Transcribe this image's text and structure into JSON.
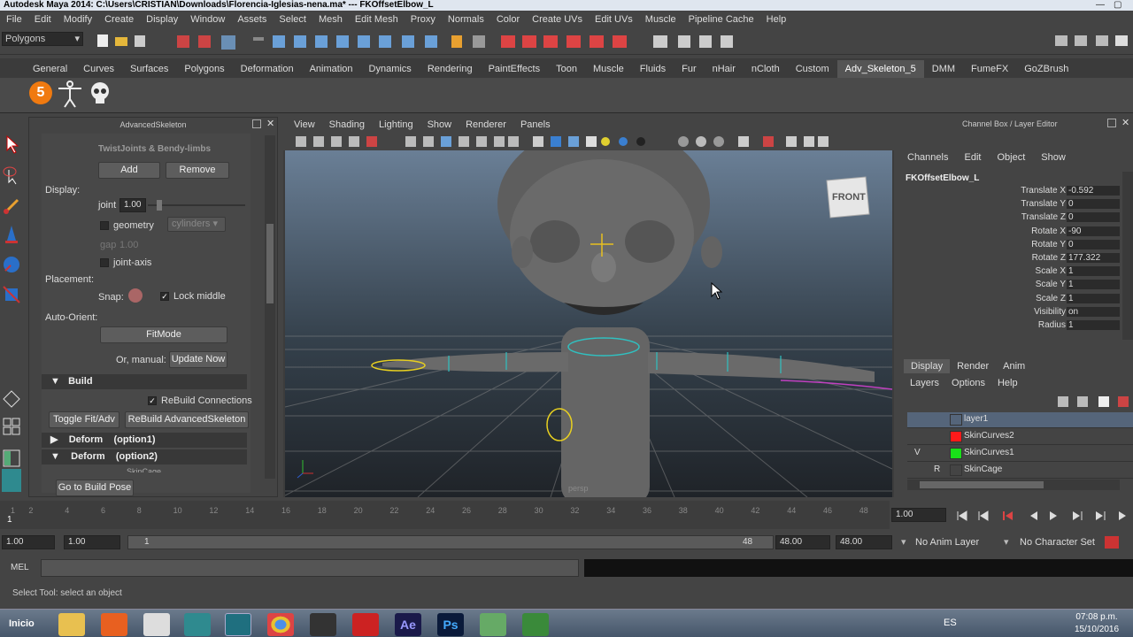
{
  "window": {
    "title": "Autodesk Maya 2014: C:\\Users\\CRISTIAN\\Downloads\\Florencia-Iglesias-nena.ma*   ---   FKOffsetElbow_L"
  },
  "menubar": [
    "File",
    "Edit",
    "Modify",
    "Create",
    "Display",
    "Window",
    "Assets",
    "Select",
    "Mesh",
    "Edit Mesh",
    "Proxy",
    "Normals",
    "Color",
    "Create UVs",
    "Edit UVs",
    "Muscle",
    "Pipeline Cache",
    "Help"
  ],
  "mode_menu": "Polygons",
  "shelf_tabs": [
    "General",
    "Curves",
    "Surfaces",
    "Polygons",
    "Deformation",
    "Animation",
    "Dynamics",
    "Rendering",
    "PaintEffects",
    "Toon",
    "Muscle",
    "Fluids",
    "Fur",
    "nHair",
    "nCloth",
    "Custom",
    "Adv_Skeleton_5",
    "DMM",
    "FumeFX",
    "GoZBrush"
  ],
  "advanced_skeleton": {
    "title": "AdvancedSkeleton",
    "twist_header": "TwistJoints & Bendy-limbs",
    "add": "Add",
    "remove": "Remove",
    "display_label": "Display:",
    "joint_label": "joint",
    "joint_value": "1.00",
    "geometry_label": "geometry",
    "geometry_option": "cylinders",
    "gap_label": "gap",
    "gap_value": "1.00",
    "joint_axis_label": "joint-axis",
    "placement_label": "Placement:",
    "snap_label": "Snap:",
    "lock_middle": "Lock middle",
    "auto_orient_label": "Auto-Orient:",
    "fitmode": "FitMode",
    "or_manual": "Or, manual:",
    "update_now": "Update Now",
    "build": "Build",
    "rebuild_connections": "ReBuild Connections",
    "toggle_fit": "Toggle Fit/Adv",
    "rebuild_adv": "ReBuild AdvancedSkeleton",
    "deform1": "Deform",
    "deform1_opt": "(option1)",
    "deform2": "Deform",
    "deform2_opt": "(option2)",
    "skin_cage": "SkinCage",
    "go_build_pose": "Go to Build Pose"
  },
  "viewport": {
    "menus": [
      "View",
      "Shading",
      "Lighting",
      "Show",
      "Renderer",
      "Panels"
    ],
    "view_cube": "FRONT",
    "camera": "persp"
  },
  "channel_box": {
    "title": "Channel Box / Layer Editor",
    "menus": [
      "Channels",
      "Edit",
      "Object",
      "Show"
    ],
    "object": "FKOffsetElbow_L",
    "channels": [
      {
        "name": "Translate X",
        "value": "-0.592"
      },
      {
        "name": "Translate Y",
        "value": "0"
      },
      {
        "name": "Translate Z",
        "value": "0"
      },
      {
        "name": "Rotate X",
        "value": "-90"
      },
      {
        "name": "Rotate Y",
        "value": "0"
      },
      {
        "name": "Rotate Z",
        "value": "177.322"
      },
      {
        "name": "Scale X",
        "value": "1"
      },
      {
        "name": "Scale Y",
        "value": "1"
      },
      {
        "name": "Scale Z",
        "value": "1"
      },
      {
        "name": "Visibility",
        "value": "on"
      },
      {
        "name": "Radius",
        "value": "1"
      }
    ]
  },
  "layer_editor": {
    "tabs": [
      "Display",
      "Render",
      "Anim"
    ],
    "menus": [
      "Layers",
      "Options",
      "Help"
    ],
    "layers": [
      {
        "flag1": "",
        "flag2": "",
        "color": "",
        "name": "layer1"
      },
      {
        "flag1": "",
        "flag2": "",
        "color": "#ff1a1a",
        "name": "SkinCurves2"
      },
      {
        "flag1": "V",
        "flag2": "",
        "color": "#19e019",
        "name": "SkinCurves1"
      },
      {
        "flag1": "",
        "flag2": "R",
        "color": "",
        "name": "SkinCage"
      }
    ]
  },
  "timeline": {
    "ticks": [
      "1",
      "2",
      "4",
      "6",
      "8",
      "10",
      "12",
      "14",
      "16",
      "18",
      "20",
      "22",
      "24",
      "26",
      "28",
      "30",
      "32",
      "34",
      "36",
      "38",
      "40",
      "42",
      "44",
      "46",
      "48"
    ],
    "current_frame": "1",
    "current_time": "1.00"
  },
  "range": {
    "start": "1.00",
    "start2": "1.00",
    "range_start": "1",
    "range_end": "48",
    "end": "48.00",
    "end2": "48.00",
    "anim_layer": "No Anim Layer",
    "char_set": "No Character Set"
  },
  "command_line": {
    "label": "MEL"
  },
  "help_line": "Select Tool: select an object",
  "taskbar": {
    "start": "Inicio",
    "lang": "ES",
    "time": "07:08 p.m.",
    "date": "15/10/2016"
  }
}
